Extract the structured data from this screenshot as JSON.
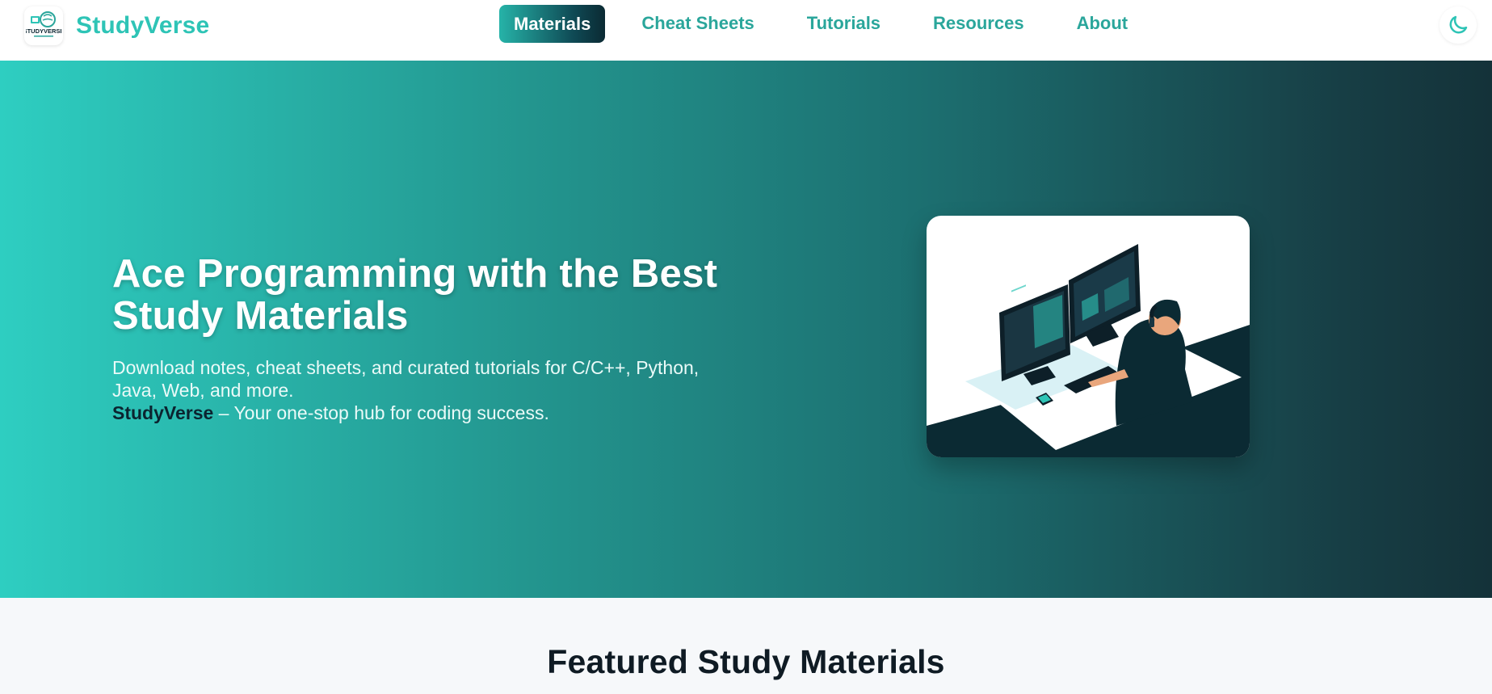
{
  "brand": {
    "name": "StudyVerse",
    "logo_icon": "studyverse-logo-icon",
    "logo_text": "STUDYVERSE"
  },
  "nav": {
    "items": [
      {
        "label": "Materials",
        "active": true
      },
      {
        "label": "Cheat Sheets",
        "active": false
      },
      {
        "label": "Tutorials",
        "active": false
      },
      {
        "label": "Resources",
        "active": false
      },
      {
        "label": "About",
        "active": false
      }
    ],
    "theme_toggle_icon": "moon-icon"
  },
  "hero": {
    "title": "Ace Programming with the Best Study Materials",
    "subtitle": "Download notes, cheat sheets, and curated tutorials for C/C++, Python, Java, Web, and more.",
    "brand_mention": "StudyVerse",
    "tagline": " – Your one-stop hub for coding success.",
    "illustration_icon": "developer-at-desk-illustration"
  },
  "featured": {
    "title": "Featured Study Materials"
  },
  "colors": {
    "accent": "#2ec4b6",
    "nav_text": "#2aa69b",
    "dark": "#0b2a33",
    "hero_start": "#2ecec1",
    "hero_end": "#143239"
  }
}
